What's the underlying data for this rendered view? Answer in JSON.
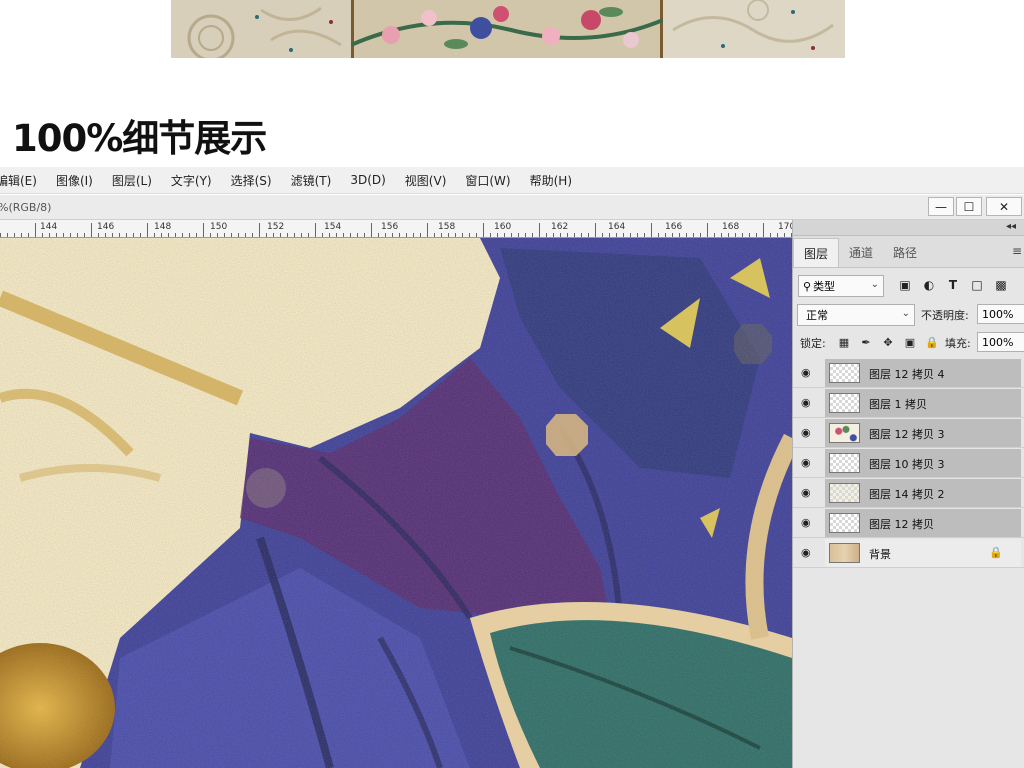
{
  "headline": "100%细节展示",
  "menubar": {
    "items": [
      "编辑(E)",
      "图像(I)",
      "图层(L)",
      "文字(Y)",
      "选择(S)",
      "滤镜(T)",
      "3D(D)",
      "视图(V)",
      "窗口(W)",
      "帮助(H)"
    ]
  },
  "document": {
    "title": "%(RGB/8)"
  },
  "window_controls": {
    "minimize": "—",
    "maximize": "☐",
    "close": "✕"
  },
  "ruler": {
    "labels": [
      "144",
      "146",
      "148",
      "150",
      "152",
      "154",
      "156",
      "158",
      "160",
      "162",
      "164",
      "166",
      "168",
      "170"
    ]
  },
  "layers_panel": {
    "collapse_glyph": "◂◂",
    "tabs": [
      "图层",
      "通道",
      "路径"
    ],
    "menu_glyph": "≡",
    "filter_kind": "类型",
    "blend_mode": "正常",
    "opacity_label": "不透明度:",
    "opacity_value": "100%",
    "lock_label": "锁定:",
    "fill_label": "填充:",
    "fill_value": "100%",
    "layers": [
      {
        "name": "图层 12 拷贝 4",
        "thumb": "transparent"
      },
      {
        "name": "图层 1 拷贝",
        "thumb": "transparent"
      },
      {
        "name": "图层 12 拷贝 3",
        "thumb": "floral"
      },
      {
        "name": "图层 10 拷贝 3",
        "thumb": "transparent"
      },
      {
        "name": "图层 14 拷贝 2",
        "thumb": "sparse"
      },
      {
        "name": "图层 12 拷贝",
        "thumb": "transparent"
      },
      {
        "name": "背景",
        "thumb": "background",
        "locked": true
      }
    ]
  },
  "colors": {
    "canvas_cream": "#f7ecd3",
    "petal_blue": "#4b4fb0",
    "petal_purple": "#5a2a6e",
    "leaf_teal": "#2e6b6a",
    "gold": "#c9962c"
  }
}
